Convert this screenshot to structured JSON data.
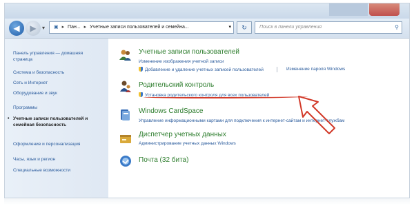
{
  "window": {
    "address": {
      "crumbs": [
        "Пан...",
        "Учетные записи пользователей и семейна..."
      ]
    },
    "search_placeholder": "Поиск в панели управления",
    "nav_arrow": "▸",
    "back_glyph": "◀",
    "forward_glyph": "▶",
    "refresh_glyph": "↻"
  },
  "sidebar": {
    "items": [
      {
        "label": "Панель управления — домашняя страница"
      },
      {
        "label": "Система и безопасность"
      },
      {
        "label": "Сеть и Интернет"
      },
      {
        "label": "Оборудование и звук"
      },
      {
        "label": "Программы"
      },
      {
        "label": "Учетные записи пользователей и семейная безопасность",
        "current": true
      },
      {
        "label": "Оформление и персонализация"
      },
      {
        "label": "Часы, язык и регион"
      },
      {
        "label": "Специальные возможности"
      }
    ]
  },
  "categories": [
    {
      "title": "Учетные записи пользователей",
      "links": [
        "Изменение изображения учетной записи",
        "Добавление и удаление учетных записей пользователей",
        "Изменение пароля Windows"
      ]
    },
    {
      "title": "Родительский контроль",
      "links": [
        "Установка родительского контроля для всех пользователей"
      ]
    },
    {
      "title": "Windows CardSpace",
      "links": [
        "Управление информационными картами для подключения к интернет-сайтам и интернет-службам"
      ]
    },
    {
      "title": "Диспетчер учетных данных",
      "links": [
        "Администрирование учетных данных Windows"
      ]
    },
    {
      "title": "Почта (32 бита)",
      "links": []
    }
  ],
  "colors": {
    "accent_link": "#2a5b9c",
    "category_green": "#2d7d2d",
    "annotation_red": "#d23a2a"
  },
  "icons": {
    "user_accounts": "user-accounts-icon",
    "parental": "parental-control-icon",
    "cardspace": "cardspace-icon",
    "credentials": "credential-manager-icon",
    "mail": "mail-icon"
  }
}
